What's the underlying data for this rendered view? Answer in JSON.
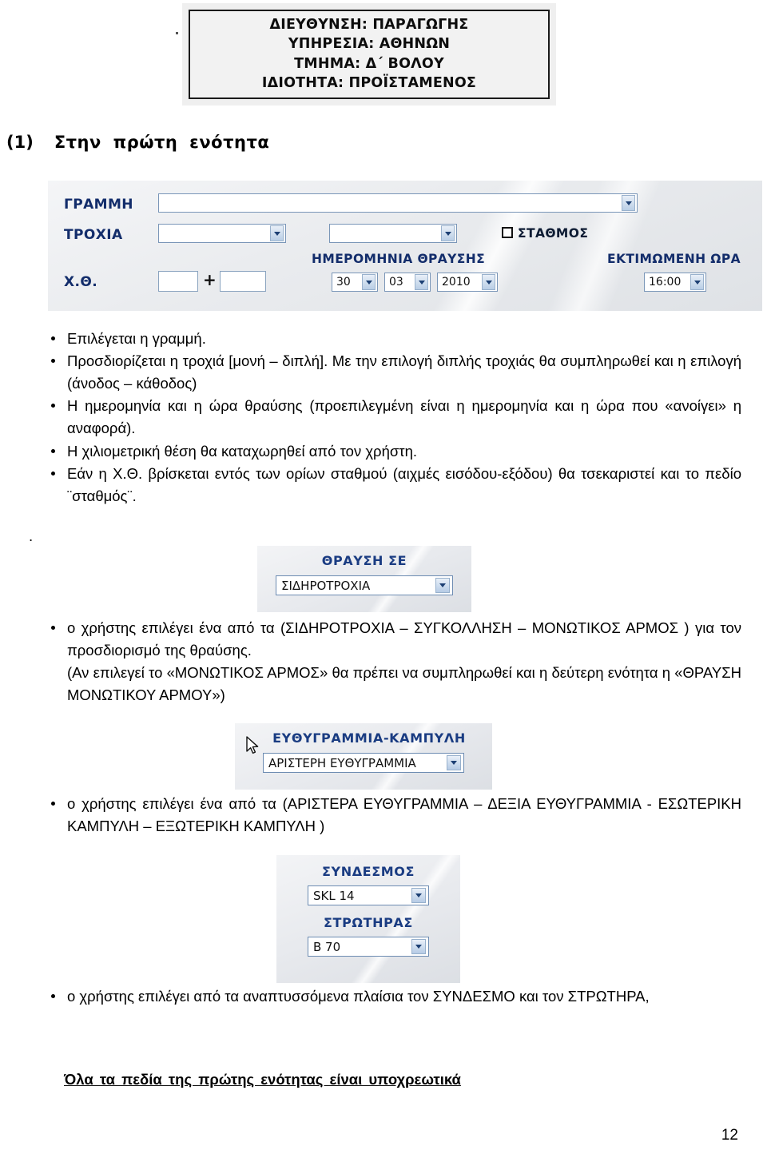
{
  "header_screenshot": {
    "lines": [
      "ΔΙΕΥΘΥΝΣΗ: ΠΑΡΑΓΩΓΗΣ",
      "ΥΠΗΡΕΣΙΑ: ΑΘΗΝΩΝ",
      "ΤΜΗΜΑ: Δ΄ ΒΟΛΟΥ",
      "ΙΔΙΟΤΗΤΑ: ΠΡΟΪΣΤΑΜΕΝΟΣ"
    ]
  },
  "section": {
    "number": "(1)",
    "title": "Στην πρώτη ενότητα"
  },
  "form_screenshot": {
    "labels": {
      "grammi": "ΓΡΑΜΜΗ",
      "troxia": "ΤΡΟΧΙΑ",
      "xtheta": "Χ.Θ.",
      "stathmos": "ΣΤΑΘΜΟΣ",
      "date_header": "ΗΜΕΡΟΜΗΝΙΑ ΘΡΑΥΣΗΣ",
      "time_header": "ΕΚΤΙΜΩΜΕΝΗ ΩΡΑ"
    },
    "values": {
      "grammi": "",
      "troxia_a": "",
      "troxia_b": "",
      "xtheta_km": "",
      "xtheta_m": "",
      "plus": "+",
      "day": "30",
      "month": "03",
      "year": "2010",
      "time": "16:00",
      "stathmos_checked": false
    }
  },
  "bullets_group1": [
    "Επιλέγεται η γραμμή.",
    "Προσδιορίζεται η τροχιά [μονή – διπλή]. Με την επιλογή διπλής τροχιάς θα συμπληρωθεί και η επιλογή (άνοδος – κάθοδος)",
    "Η ημερομηνία και η ώρα θραύσης (προεπιλεγμένη είναι η ημερομηνία και η ώρα που «ανοίγει» η αναφορά).",
    "Η χιλιομετρική θέση θα καταχωρηθεί από τον χρήστη.",
    "Εάν η Χ.Θ. βρίσκεται εντός των ορίων σταθμού (αιχμές εισόδου-εξόδου) θα τσεκαριστεί και το πεδίο ¨σταθμός¨."
  ],
  "lone_dot": ".",
  "mini_shot_thrausi": {
    "title": "ΘΡΑΥΣΗ ΣΕ",
    "value": "ΣΙΔΗΡΟΤΡΟΧΙΑ"
  },
  "bullets_group2": [
    "ο χρήστης επιλέγει  ένα από τα (ΣΙΔΗΡΟΤΡΟΧΙΑ – ΣΥΓΚΟΛΛΗΣΗ – ΜΟΝΩΤΙΚΟΣ ΑΡΜΟΣ ) για τον προσδιορισμό της θραύσης.",
    "(Αν επιλεγεί το «ΜΟΝΩΤΙΚΟΣ ΑΡΜΟΣ» θα πρέπει να συμπληρωθεί και η δεύτερη ενότητα η «ΘΡΑΥΣΗ ΜΟΝΩΤΙΚΟΥ ΑΡΜΟΥ»)"
  ],
  "mini_shot_efthigrammia": {
    "title": "ΕΥΘΥΓΡΑΜΜΙΑ-ΚΑΜΠΥΛΗ",
    "value": "ΑΡΙΣΤΕΡΗ ΕΥΘΥΓΡΑΜΜΙΑ",
    "cursor": "mouse-pointer"
  },
  "bullets_group3": [
    "ο χρήστης επιλέγει  ένα από τα (ΑΡΙΣΤΕΡΑ ΕΥΘΥΓΡΑΜΜΙΑ – ΔΕΞΙΑ ΕΥΘΥΓΡΑΜΜΙΑ -  ΕΣΩΤΕΡΙΚΗ  ΚΑΜΠΥΛΗ – ΕΞΩΤΕΡΙΚΗ ΚΑΜΠΥΛΗ )"
  ],
  "mini_shot_syndesmos": {
    "title_1": "ΣΥΝΔΕΣΜΟΣ",
    "value_1": "SKL 14",
    "title_2": "ΣΤΡΩΤΗΡΑΣ",
    "value_2": "B 70"
  },
  "bullets_group4": [
    "ο χρήστης επιλέγει  από τα αναπτυσσόμενα πλαίσια τον ΣΥΝΔΕΣΜΟ  και τον ΣΤΡΩΤΗΡΑ,"
  ],
  "final_note": "Όλα τα πεδία της πρώτης ενότητας  είναι υποχρεωτικά",
  "page_number": "12",
  "colors": {
    "label_blue": "#132d6b",
    "mini_title_blue": "#1a3c82",
    "text_black": "#000000"
  }
}
